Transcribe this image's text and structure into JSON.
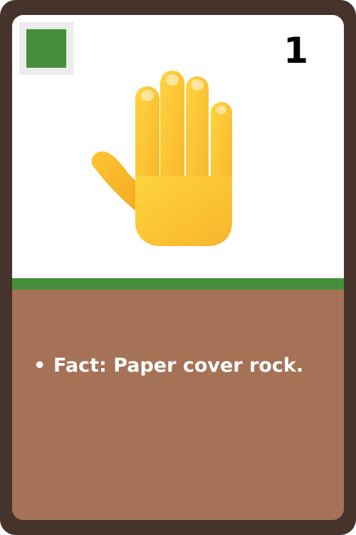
{
  "card": {
    "cost": "1",
    "element_color": "#458f3a",
    "art_icon": "raised-hand-icon",
    "fact": "Fact: Paper cover rock.",
    "bullet": "•"
  },
  "colors": {
    "frame": "#45332c",
    "art_background": "#ffffff",
    "divider": "#458f3a",
    "text_background": "#a67257",
    "text": "#ffffff"
  }
}
